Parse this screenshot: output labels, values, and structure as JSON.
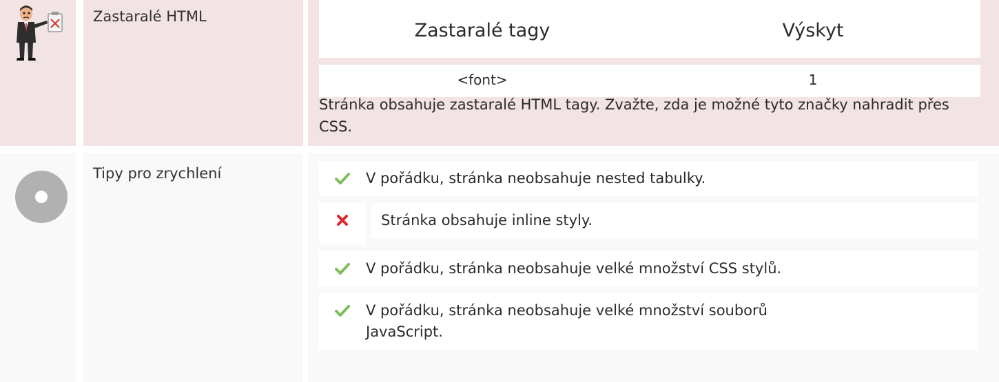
{
  "deprecated": {
    "label": "Zastaralé HTML",
    "headers": [
      "Zastaralé tagy",
      "Výskyt"
    ],
    "rows": [
      {
        "tag": "<font>",
        "count": "1"
      }
    ],
    "note": "Stránka obsahuje zastaralé HTML tagy. Zvažte, zda je možné tyto značky nahradit přes CSS.",
    "icon": "businessman-warning-icon",
    "bg_color": "#f2e3e4"
  },
  "speed_tips": {
    "label": "Tipy pro zrychlení",
    "icon": "gray-circle-icon",
    "items": [
      {
        "status": "ok",
        "icon": "check-icon",
        "text": "V pořádku, stránka neobsahuje nested tabulky."
      },
      {
        "status": "fail",
        "icon": "cross-icon",
        "text": "Stránka obsahuje inline styly."
      },
      {
        "status": "ok",
        "icon": "check-icon",
        "text": "V pořádku, stránka neobsahuje velké množství CSS stylů."
      },
      {
        "status": "ok",
        "icon": "check-icon",
        "text": "V pořádku, stránka neobsahuje velké množství souborů JavaScript."
      }
    ],
    "colors": {
      "check": "#7cbf5a",
      "cross": "#e0262b"
    }
  }
}
